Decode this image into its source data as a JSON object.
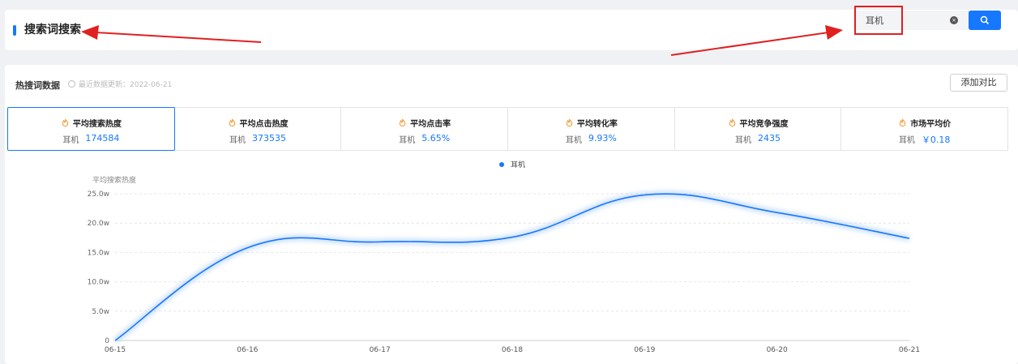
{
  "header": {
    "title": "搜索词搜索",
    "search": {
      "value": "耳机",
      "placeholder": ""
    },
    "clear_glyph": "×"
  },
  "panel": {
    "title": "热搜词数据",
    "update_text": "最近数据更新：2022-06-21",
    "compare_label": "添加对比"
  },
  "metrics": [
    {
      "label": "平均搜索热度",
      "keyword": "耳机",
      "value": "174584"
    },
    {
      "label": "平均点击热度",
      "keyword": "耳机",
      "value": "373535"
    },
    {
      "label": "平均点击率",
      "keyword": "耳机",
      "value": "5.65%"
    },
    {
      "label": "平均转化率",
      "keyword": "耳机",
      "value": "9.93%"
    },
    {
      "label": "平均竞争强度",
      "keyword": "耳机",
      "value": "2435"
    },
    {
      "label": "市场平均价",
      "keyword": "耳机",
      "value": "￥0.18"
    }
  ],
  "colors": {
    "accent": "#1677ff",
    "annotation": "#e02020"
  },
  "chart_data": {
    "type": "line",
    "ylabel": "平均搜索热度",
    "x": [
      "06-15",
      "06-16",
      "06-17",
      "06-18",
      "06-19",
      "06-20",
      "06-21"
    ],
    "y_ticks": [
      "0",
      "5.0w",
      "10.0w",
      "15.0w",
      "20.0w",
      "25.0w"
    ],
    "ylim": [
      0,
      250000
    ],
    "series": [
      {
        "name": "耳机",
        "values": [
          0,
          158000,
          168000,
          176000,
          248000,
          218000,
          174000
        ]
      }
    ],
    "grid": true,
    "legend": "top-center"
  }
}
